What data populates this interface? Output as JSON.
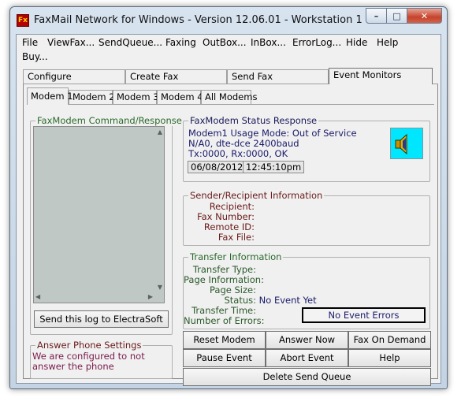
{
  "window": {
    "title": "FaxMail Network for Windows - Version 12.06.01 - Workstation 1",
    "icon_text": "Fx",
    "controls": {
      "minimize": "–",
      "maximize": "□",
      "close": "✕"
    }
  },
  "menu": [
    "File",
    "ViewFax...",
    "SendQueue...",
    "Faxing",
    "OutBox...",
    "InBox...",
    "ErrorLog...",
    "Hide",
    "Help",
    "Buy..."
  ],
  "main_tabs": [
    "Configure",
    "Create Fax",
    "Send Fax",
    "Event Monitors"
  ],
  "modem_tabs": [
    "Modem 1",
    "Modem 2",
    "Modem 3",
    "Modem 4",
    "All Modems"
  ],
  "command_response": {
    "title": "FaxModem Command/Response",
    "send_log_button": "Send this log to ElectraSoft"
  },
  "answer_phone": {
    "title": "Answer Phone Settings",
    "text": "We are configured to not answer the phone"
  },
  "status_response": {
    "title": "FaxModem Status Response",
    "line1": "Modem1 Usage Mode: Out of Service",
    "line2": "N/A0, dte-dce 2400baud",
    "line3": "Tx:0000, Rx:0000, OK",
    "date": "06/08/2012",
    "time": "12:45:10pm",
    "speaker_icon": "speaker-icon"
  },
  "sender_recipient": {
    "title": "Sender/Recipient Information",
    "labels": [
      "Recipient:",
      "Fax Number:",
      "Remote ID:",
      "Fax File:"
    ]
  },
  "transfer": {
    "title": "Transfer Information",
    "labels": [
      "Transfer Type:",
      "Page Information:",
      "Page Size:",
      "Status:",
      "Transfer Time:",
      "Number of Errors:"
    ],
    "status_value": "No Event Yet",
    "errors_button": "No Event Errors"
  },
  "actions": {
    "reset_modem": "Reset Modem",
    "answer_now": "Answer Now",
    "fax_on_demand": "Fax On Demand",
    "pause_event": "Pause Event",
    "abort_event": "Abort Event",
    "help": "Help",
    "delete_send_queue": "Delete Send Queue"
  },
  "colors": {
    "title_green": "#2a6a2a",
    "title_navy": "#1a1a5a",
    "label_maroon": "#6b1a1a",
    "value_navy": "#1a1a6a",
    "speaker_bg": "#00e6ff"
  }
}
